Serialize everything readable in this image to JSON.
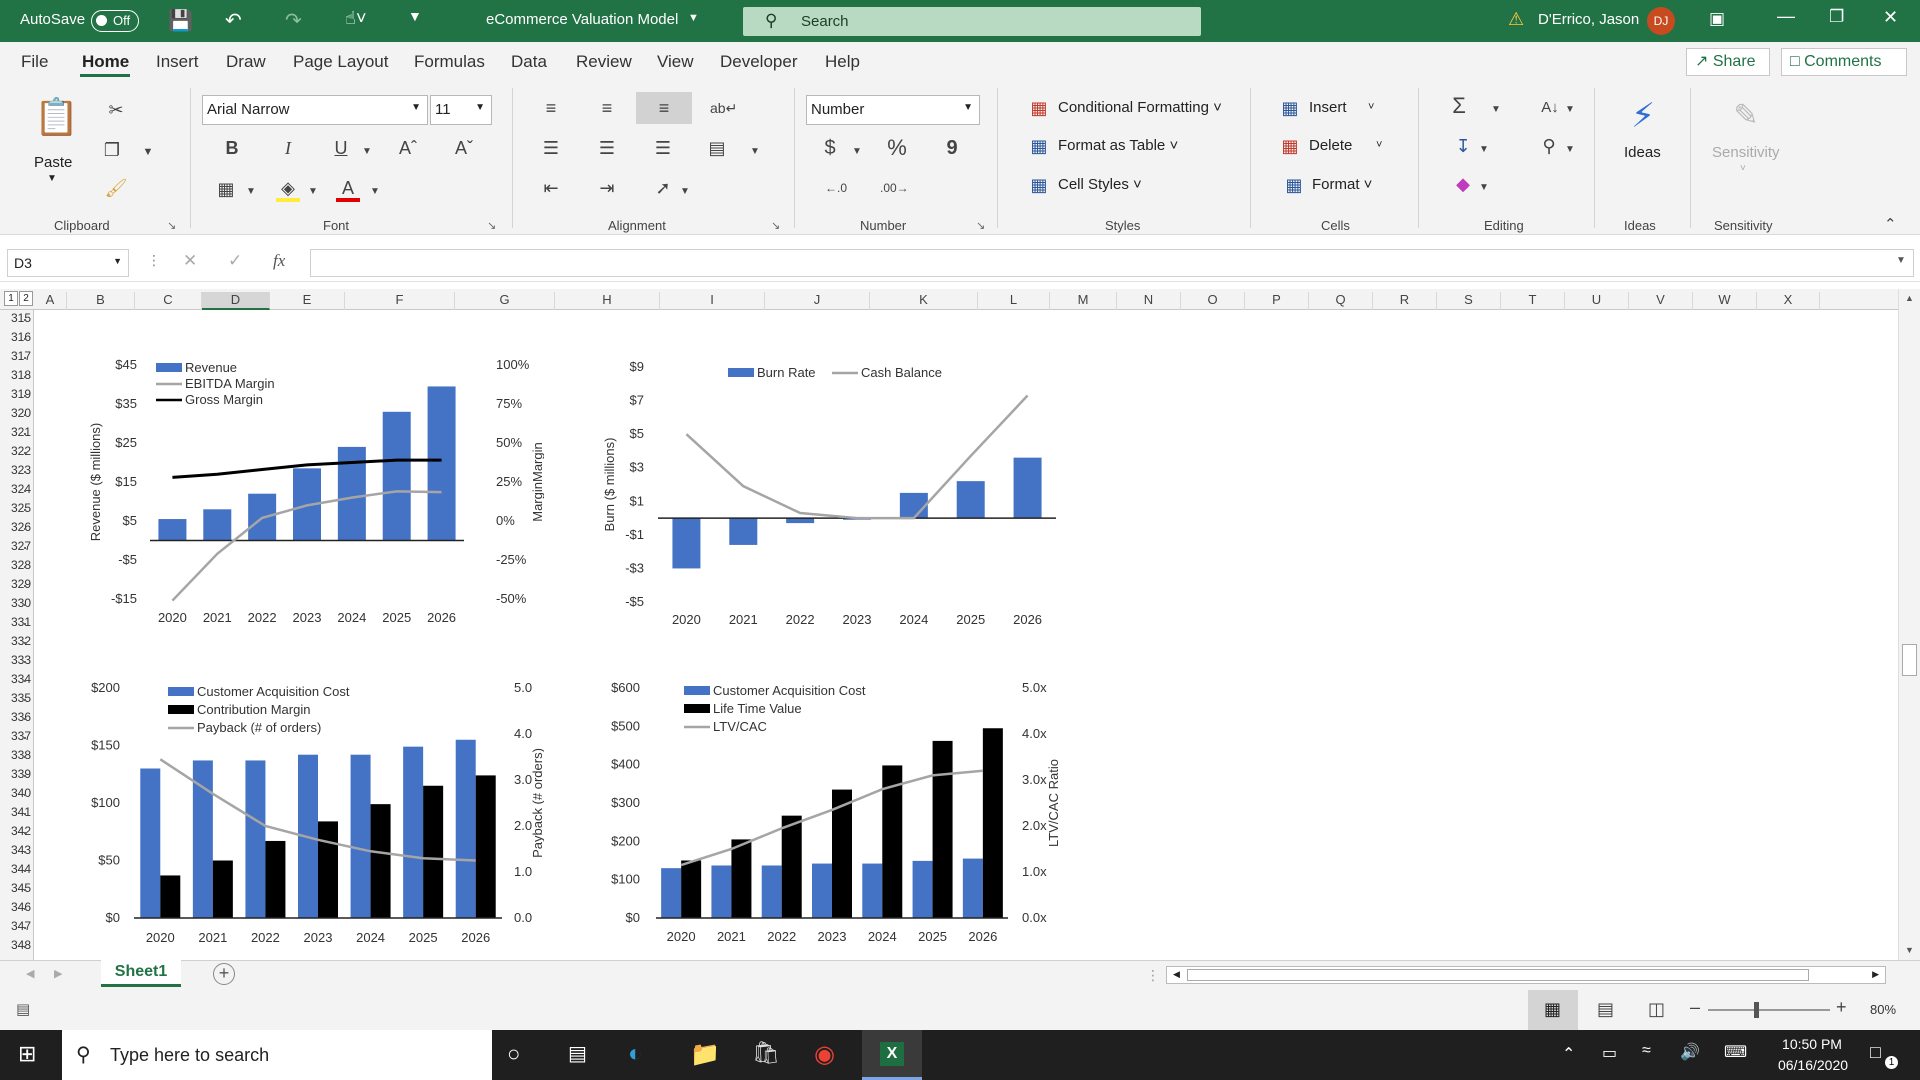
{
  "titlebar": {
    "autosave_label": "AutoSave",
    "autosave_state": "Off",
    "filename": "eCommerce Valuation Model",
    "search_placeholder": "Search",
    "user": "D'Errico, Jason",
    "user_initials": "DJ"
  },
  "menu": {
    "items": [
      "File",
      "Home",
      "Insert",
      "Draw",
      "Page Layout",
      "Formulas",
      "Data",
      "Review",
      "View",
      "Developer",
      "Help"
    ],
    "active": "Home",
    "share": "Share",
    "comments": "Comments"
  },
  "ribbon": {
    "clipboard": {
      "paste": "Paste",
      "group": "Clipboard"
    },
    "font": {
      "name": "Arial Narrow",
      "size": "11",
      "bold": "B",
      "italic": "I",
      "underline": "U",
      "group": "Font"
    },
    "alignment": {
      "group": "Alignment"
    },
    "number": {
      "format": "Number",
      "currency": "$",
      "percent": "%",
      "comma": "9",
      "group": "Number"
    },
    "styles": {
      "conditional": "Conditional Formatting",
      "table": "Format as Table",
      "cell": "Cell Styles",
      "group": "Styles"
    },
    "cells": {
      "insert": "Insert",
      "delete": "Delete",
      "format": "Format",
      "group": "Cells"
    },
    "editing": {
      "group": "Editing"
    },
    "ideas": {
      "label": "Ideas",
      "group": "Ideas"
    },
    "sensitivity": {
      "label": "Sensitivity",
      "group": "Sensitivity"
    }
  },
  "formula_bar": {
    "name_box": "D3",
    "fx": "fx",
    "value": ""
  },
  "sheet": {
    "columns": [
      "A",
      "B",
      "C",
      "D",
      "E",
      "F",
      "G",
      "H",
      "I",
      "J",
      "K",
      "L",
      "M",
      "N",
      "O",
      "P",
      "Q",
      "R",
      "S",
      "T",
      "U",
      "V",
      "W",
      "X"
    ],
    "rows": [
      "315",
      "316",
      "317",
      "318",
      "319",
      "320",
      "321",
      "322",
      "323",
      "324",
      "325",
      "326",
      "327",
      "328",
      "329",
      "330",
      "331",
      "332",
      "333",
      "334",
      "335",
      "336",
      "337",
      "338",
      "339",
      "340",
      "341",
      "342",
      "343",
      "344",
      "345",
      "346",
      "347",
      "348"
    ],
    "outline_levels": [
      "1",
      "2"
    ],
    "tab": "Sheet1"
  },
  "status": {
    "zoom": "80%"
  },
  "taskbar": {
    "search_placeholder": "Type here to search",
    "time": "10:50 PM",
    "date": "06/16/2020",
    "notifications": "1"
  },
  "chart_data": [
    {
      "type": "bar",
      "title": "",
      "categories": [
        "2020",
        "2021",
        "2022",
        "2023",
        "2024",
        "2025",
        "2026"
      ],
      "series": [
        {
          "name": "Revenue",
          "kind": "bar",
          "axis": "left",
          "values": [
            5.5,
            8,
            12,
            18.5,
            24,
            33,
            39.5
          ]
        },
        {
          "name": "EBITDA Margin",
          "kind": "line",
          "axis": "right",
          "values": [
            -51,
            -21,
            2,
            10,
            15,
            19,
            18.5
          ]
        },
        {
          "name": "Gross Margin",
          "kind": "line",
          "axis": "right",
          "values": [
            28,
            30,
            33,
            36,
            37.5,
            39,
            39
          ]
        }
      ],
      "ylabel": "Revenue ($ millions)",
      "y2label": "MarginMargin",
      "yticks": [
        "$45",
        "$35",
        "$25",
        "$15",
        "$5",
        "-$5",
        "-$15"
      ],
      "y2ticks": [
        "100%",
        "75%",
        "50%",
        "25%",
        "0%",
        "-25%",
        "-50%"
      ],
      "ylim": [
        -15,
        45
      ],
      "y2lim": [
        -50,
        100
      ],
      "colors": {
        "Revenue": "#4472c4",
        "EBITDA Margin": "#a5a5a5",
        "Gross Margin": "#000000"
      },
      "legend": "top-left"
    },
    {
      "type": "bar",
      "title": "",
      "categories": [
        "2020",
        "2021",
        "2022",
        "2023",
        "2024",
        "2025",
        "2026"
      ],
      "series": [
        {
          "name": "Burn Rate",
          "kind": "bar",
          "values": [
            -3,
            -1.6,
            -0.3,
            -0.1,
            1.5,
            2.2,
            3.6
          ]
        },
        {
          "name": "Cash Balance",
          "kind": "line",
          "values": [
            5,
            1.9,
            0.3,
            0,
            0,
            3.7,
            7.3
          ]
        }
      ],
      "ylabel": "Burn ($ millions)",
      "yticks": [
        "$9",
        "$7",
        "$5",
        "$3",
        "$1",
        "-$1",
        "-$3",
        "-$5"
      ],
      "ylim": [
        -5,
        9
      ],
      "colors": {
        "Burn Rate": "#4472c4",
        "Cash Balance": "#a5a5a5"
      },
      "legend": "top"
    },
    {
      "type": "bar",
      "title": "",
      "categories": [
        "2020",
        "2021",
        "2022",
        "2023",
        "2024",
        "2025",
        "2026"
      ],
      "series": [
        {
          "name": "Customer Acquisition Cost",
          "kind": "bar",
          "axis": "left",
          "values": [
            130,
            137,
            137,
            142,
            142,
            149,
            155
          ]
        },
        {
          "name": "Contribution Margin",
          "kind": "bar",
          "axis": "left",
          "values": [
            37,
            50,
            67,
            84,
            99,
            115,
            124
          ]
        },
        {
          "name": "Payback (# of orders)",
          "kind": "line",
          "axis": "right",
          "values": [
            3.45,
            2.7,
            2.0,
            1.7,
            1.45,
            1.3,
            1.25
          ]
        }
      ],
      "y2label": "Payback (# orders)",
      "yticks": [
        "$200",
        "$150",
        "$100",
        "$50",
        "$0"
      ],
      "y2ticks": [
        "5.0",
        "4.0",
        "3.0",
        "2.0",
        "1.0",
        "0.0"
      ],
      "ylim": [
        0,
        200
      ],
      "y2lim": [
        0,
        5
      ],
      "colors": {
        "Customer Acquisition Cost": "#4472c4",
        "Contribution Margin": "#000000",
        "Payback (# of orders)": "#a5a5a5"
      },
      "legend": "top-left"
    },
    {
      "type": "bar",
      "title": "",
      "categories": [
        "2020",
        "2021",
        "2022",
        "2023",
        "2024",
        "2025",
        "2026"
      ],
      "series": [
        {
          "name": "Customer Acquisition Cost",
          "kind": "bar",
          "axis": "left",
          "values": [
            130,
            137,
            137,
            142,
            142,
            149,
            155
          ]
        },
        {
          "name": "Life Time Value",
          "kind": "bar",
          "axis": "left",
          "values": [
            150,
            205,
            267,
            335,
            398,
            462,
            495
          ]
        },
        {
          "name": "LTV/CAC",
          "kind": "line",
          "axis": "right",
          "values": [
            1.15,
            1.5,
            1.95,
            2.35,
            2.8,
            3.1,
            3.2
          ]
        }
      ],
      "y2label": "LTV/CAC Ratio",
      "yticks": [
        "$600",
        "$500",
        "$400",
        "$300",
        "$200",
        "$100",
        "$0"
      ],
      "y2ticks": [
        "5.0x",
        "4.0x",
        "3.0x",
        "2.0x",
        "1.0x",
        "0.0x"
      ],
      "ylim": [
        0,
        600
      ],
      "y2lim": [
        0,
        5
      ],
      "colors": {
        "Customer Acquisition Cost": "#4472c4",
        "Life Time Value": "#000000",
        "LTV/CAC": "#a5a5a5"
      },
      "legend": "top-left"
    }
  ]
}
